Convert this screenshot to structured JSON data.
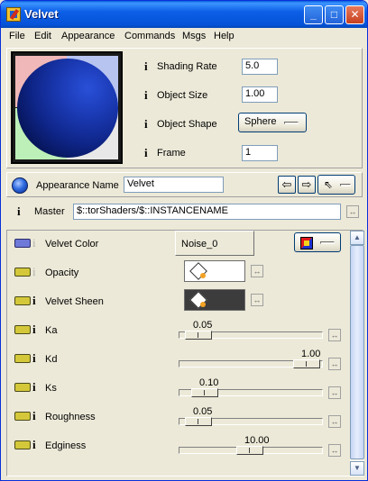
{
  "window": {
    "title": "Velvet"
  },
  "titlebar_buttons": {
    "minimize": "_",
    "maximize": "□",
    "close": "✕"
  },
  "menu": [
    "File",
    "Edit",
    "Appearance",
    "Commands",
    "Msgs",
    "Help"
  ],
  "properties": [
    {
      "label": "Shading Rate",
      "value": "5.0"
    },
    {
      "label": "Object Size",
      "value": "1.00"
    },
    {
      "label": "Object Shape",
      "value": "Sphere"
    },
    {
      "label": "Frame",
      "value": "1"
    }
  ],
  "appearance": {
    "name_label": "Appearance Name",
    "name_value": "Velvet",
    "master_label": "Master",
    "master_value": "$::torShaders/$::INSTANCENAME"
  },
  "params": [
    {
      "label": "Velvet Color",
      "value": "Noise_0"
    },
    {
      "label": "Opacity"
    },
    {
      "label": "Velvet Sheen"
    },
    {
      "label": "Ka",
      "value": "0.05",
      "fraction": 0.05
    },
    {
      "label": "Kd",
      "value": "1.00",
      "fraction": 1.0
    },
    {
      "label": "Ks",
      "value": "0.10",
      "fraction": 0.1
    },
    {
      "label": "Roughness",
      "value": "0.05",
      "fraction": 0.05
    },
    {
      "label": "Edginess",
      "value": "10.00",
      "fraction": 0.5
    }
  ],
  "colors": {
    "accent_blue": "#0d5fe7",
    "chip_yellow": "#d4c83a",
    "chip_blue": "#6f79d8",
    "sheen_swatch": "#3c3c3c"
  }
}
